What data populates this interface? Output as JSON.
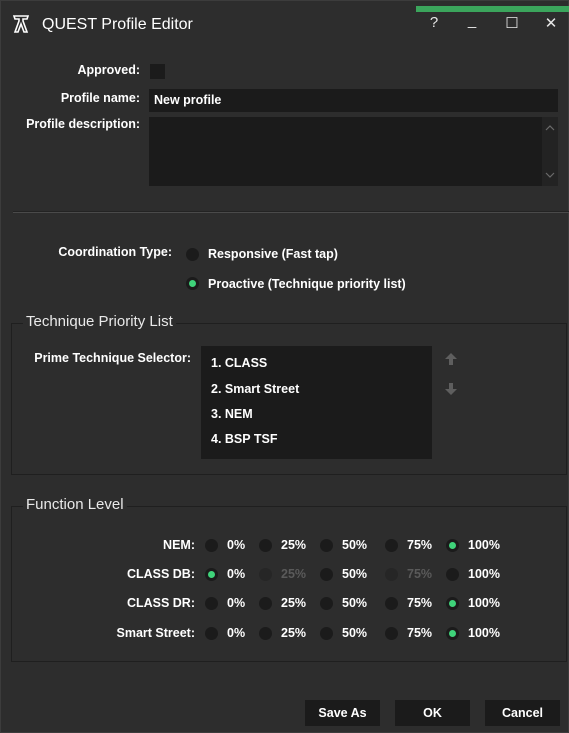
{
  "window": {
    "title": "QUEST Profile Editor",
    "controls": {
      "help": "?",
      "minimize": "_",
      "maximize": "☐",
      "close": "✕"
    },
    "accent_color": "#3ba55c"
  },
  "profile": {
    "approved_label": "Approved:",
    "approved_checked": false,
    "name_label": "Profile name:",
    "name_value": "New profile",
    "description_label": "Profile description:",
    "description_value": ""
  },
  "coordination": {
    "label": "Coordination Type:",
    "options": [
      {
        "label": "Responsive (Fast tap)",
        "selected": false
      },
      {
        "label": "Proactive (Technique priority list)",
        "selected": true
      }
    ]
  },
  "technique_priority": {
    "title": "Technique Priority List",
    "selector_label": "Prime Technique Selector:",
    "items": [
      "1. CLASS",
      "2. Smart Street",
      "3. NEM",
      "4. BSP TSF"
    ],
    "up_icon": "arrow-up-icon",
    "down_icon": "arrow-down-icon"
  },
  "function_level": {
    "title": "Function Level",
    "levels": [
      "0%",
      "25%",
      "50%",
      "75%",
      "100%"
    ],
    "rows": [
      {
        "label": "NEM:",
        "selected": 4,
        "disabled": []
      },
      {
        "label": "CLASS DB:",
        "selected": 0,
        "disabled": [
          1,
          3
        ]
      },
      {
        "label": "CLASS DR:",
        "selected": 4,
        "disabled": []
      },
      {
        "label": "Smart Street:",
        "selected": 4,
        "disabled": []
      }
    ],
    "selected_color": "#3fd37a"
  },
  "buttons": {
    "save_as": "Save As",
    "ok": "OK",
    "cancel": "Cancel"
  }
}
